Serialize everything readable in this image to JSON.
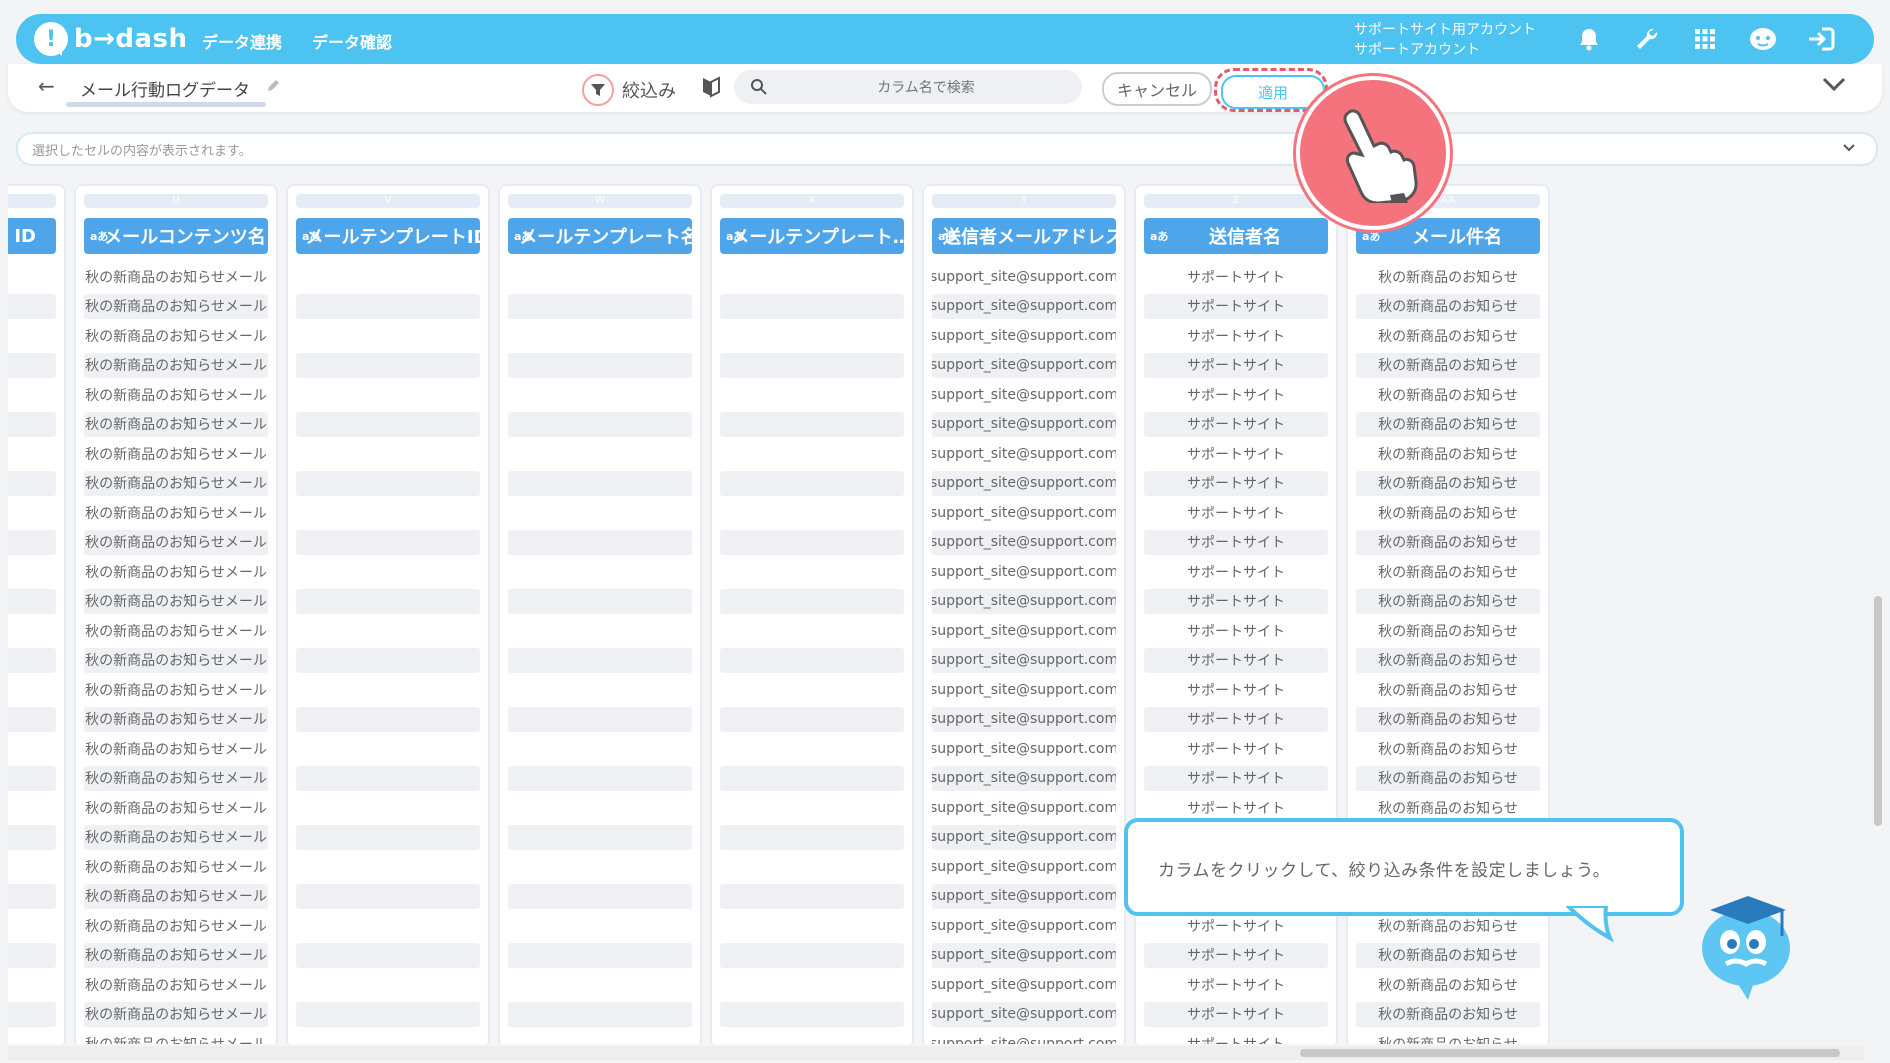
{
  "header": {
    "logo_glyph": "!",
    "logo_text": "b→dash",
    "nav": [
      "データ連携",
      "データ確認"
    ],
    "account_line1": "サポートサイト用アカウント",
    "account_line2": "サポートアカウント",
    "icons": [
      "bell-icon",
      "wrench-icon",
      "apps-grid-icon",
      "support-mascot-icon",
      "logout-icon"
    ]
  },
  "toolbar": {
    "back_glyph": "←",
    "title": "メール行動ログデータ",
    "filter_label": "絞込み",
    "search_placeholder": "カラム名で検索",
    "cancel_label": "キャンセル",
    "apply_label": "適用"
  },
  "cellbar": {
    "placeholder": "選択したセルの内容が表示されます。"
  },
  "columns": [
    {
      "letter": "",
      "header": "ID",
      "type_badge": ""
    },
    {
      "letter": "U",
      "header": "メールコンテンツ名",
      "type_badge": "aあ",
      "cell": "秋の新商品のお知らせメール"
    },
    {
      "letter": "V",
      "header": "メールテンプレートID",
      "type_badge": "aあ",
      "cell": ""
    },
    {
      "letter": "W",
      "header": "メールテンプレート名",
      "type_badge": "aあ",
      "cell": ""
    },
    {
      "letter": "X",
      "header": "メールテンプレート…",
      "type_badge": "aあ",
      "cell": ""
    },
    {
      "letter": "Y",
      "header": "送信者メールアドレス",
      "type_badge": "aあ",
      "cell": "support_site@support.com"
    },
    {
      "letter": "Z",
      "header": "送信者名",
      "type_badge": "aあ",
      "cell": "サポートサイト"
    },
    {
      "letter": "AA",
      "header": "メール件名",
      "type_badge": "aあ",
      "cell": "秋の新商品のお知らせ"
    }
  ],
  "tooltip": {
    "text": "カラムをクリックして、絞り込み条件を設定しましょう。"
  },
  "colors": {
    "brand": "#4cc3f0",
    "header_cell": "#4fa5ea",
    "highlight": "#f4737c"
  }
}
